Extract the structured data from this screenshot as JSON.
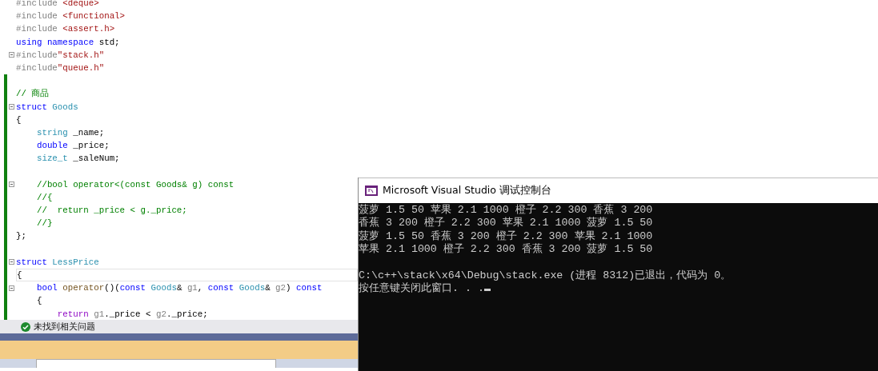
{
  "editor": {
    "lines": [
      {
        "foldable": false,
        "changed": false,
        "current": false,
        "tokens": [
          {
            "kind": "pre",
            "text": "#include "
          },
          {
            "kind": "str",
            "text": "<deque>"
          }
        ]
      },
      {
        "foldable": false,
        "changed": false,
        "current": false,
        "tokens": [
          {
            "kind": "pre",
            "text": "#include "
          },
          {
            "kind": "str",
            "text": "<functional>"
          }
        ]
      },
      {
        "foldable": false,
        "changed": false,
        "current": false,
        "tokens": [
          {
            "kind": "pre",
            "text": "#include "
          },
          {
            "kind": "str",
            "text": "<assert.h>"
          }
        ]
      },
      {
        "foldable": false,
        "changed": false,
        "current": false,
        "tokens": [
          {
            "kind": "kw",
            "text": "using namespace"
          },
          {
            "kind": "plain",
            "text": " std;"
          }
        ]
      },
      {
        "foldable": true,
        "changed": false,
        "current": false,
        "tokens": [
          {
            "kind": "pre",
            "text": "#include"
          },
          {
            "kind": "str",
            "text": "\"stack.h\""
          }
        ]
      },
      {
        "foldable": false,
        "changed": false,
        "current": false,
        "tokens": [
          {
            "kind": "pre",
            "text": "#include"
          },
          {
            "kind": "str",
            "text": "\"queue.h\""
          }
        ]
      },
      {
        "foldable": false,
        "changed": true,
        "current": false
      },
      {
        "foldable": false,
        "changed": true,
        "current": false,
        "tokens": [
          {
            "kind": "cm",
            "text": "// 商品"
          }
        ]
      },
      {
        "foldable": true,
        "changed": true,
        "current": false,
        "tokens": [
          {
            "kind": "kw",
            "text": "struct"
          },
          {
            "kind": "type",
            "text": " Goods"
          }
        ]
      },
      {
        "foldable": false,
        "changed": true,
        "current": false,
        "tokens": [
          {
            "kind": "plain",
            "text": "{"
          }
        ]
      },
      {
        "foldable": false,
        "changed": true,
        "current": false,
        "tokens": [
          {
            "kind": "type",
            "text": "    string"
          },
          {
            "kind": "plain",
            "text": " _name;"
          }
        ]
      },
      {
        "foldable": false,
        "changed": true,
        "current": false,
        "tokens": [
          {
            "kind": "kw",
            "text": "    double"
          },
          {
            "kind": "plain",
            "text": " _price;"
          }
        ]
      },
      {
        "foldable": false,
        "changed": true,
        "current": false,
        "tokens": [
          {
            "kind": "type",
            "text": "    size_t"
          },
          {
            "kind": "plain",
            "text": " _saleNum;"
          }
        ]
      },
      {
        "foldable": false,
        "changed": true,
        "current": false
      },
      {
        "foldable": true,
        "changed": true,
        "current": false,
        "tokens": [
          {
            "kind": "cm",
            "text": "    //bool operator<(const Goods& g) const"
          }
        ]
      },
      {
        "foldable": false,
        "changed": true,
        "current": false,
        "tokens": [
          {
            "kind": "cm",
            "text": "    //{"
          }
        ]
      },
      {
        "foldable": false,
        "changed": true,
        "current": false,
        "tokens": [
          {
            "kind": "cm",
            "text": "    //  return _price < g._price;"
          }
        ]
      },
      {
        "foldable": false,
        "changed": true,
        "current": false,
        "tokens": [
          {
            "kind": "cm",
            "text": "    //}"
          }
        ]
      },
      {
        "foldable": false,
        "changed": true,
        "current": false,
        "tokens": [
          {
            "kind": "plain",
            "text": "};"
          }
        ]
      },
      {
        "foldable": false,
        "changed": true,
        "current": false
      },
      {
        "foldable": true,
        "changed": true,
        "current": false,
        "tokens": [
          {
            "kind": "kw",
            "text": "struct"
          },
          {
            "kind": "type",
            "text": " LessPrice"
          }
        ]
      },
      {
        "foldable": false,
        "changed": true,
        "current": true,
        "tokens": [
          {
            "kind": "plain",
            "text": "{"
          }
        ]
      },
      {
        "foldable": true,
        "changed": true,
        "current": false,
        "tokens": [
          {
            "kind": "kw",
            "text": "    bool"
          },
          {
            "kind": "func",
            "text": " operator"
          },
          {
            "kind": "plain",
            "text": "()("
          },
          {
            "kind": "kw",
            "text": "const"
          },
          {
            "kind": "type",
            "text": " Goods"
          },
          {
            "kind": "plain",
            "text": "& "
          },
          {
            "kind": "param",
            "text": "g1"
          },
          {
            "kind": "plain",
            "text": ", "
          },
          {
            "kind": "kw",
            "text": "const"
          },
          {
            "kind": "type",
            "text": " Goods"
          },
          {
            "kind": "plain",
            "text": "& "
          },
          {
            "kind": "param",
            "text": "g2"
          },
          {
            "kind": "plain",
            "text": ") "
          },
          {
            "kind": "kw",
            "text": "const"
          }
        ]
      },
      {
        "foldable": false,
        "changed": true,
        "current": false,
        "tokens": [
          {
            "kind": "plain",
            "text": "    {"
          }
        ]
      },
      {
        "foldable": false,
        "changed": true,
        "current": false,
        "tokens": [
          {
            "kind": "ctrl",
            "text": "        return"
          },
          {
            "kind": "param",
            "text": " g1"
          },
          {
            "kind": "plain",
            "text": "._price < "
          },
          {
            "kind": "param",
            "text": "g2"
          },
          {
            "kind": "plain",
            "text": "._price;"
          }
        ]
      }
    ]
  },
  "status_bar": {
    "text": "未找到相关问题"
  },
  "console": {
    "title": "Microsoft Visual Studio 调试控制台",
    "results": [
      "菠萝 1.5 50 苹果 2.1 1000 橙子 2.2 300 香蕉 3 200",
      "香蕉 3 200 橙子 2.2 300 苹果 2.1 1000 菠萝 1.5 50",
      "菠萝 1.5 50 香蕉 3 200 橙子 2.2 300 苹果 2.1 1000",
      "苹果 2.1 1000 橙子 2.2 300 香蕉 3 200 菠萝 1.5 50"
    ],
    "messages": [
      "C:\\c++\\stack\\x64\\Debug\\stack.exe (进程 8312)已退出，代码为 0。",
      "按任意键关闭此窗口. . ."
    ]
  }
}
